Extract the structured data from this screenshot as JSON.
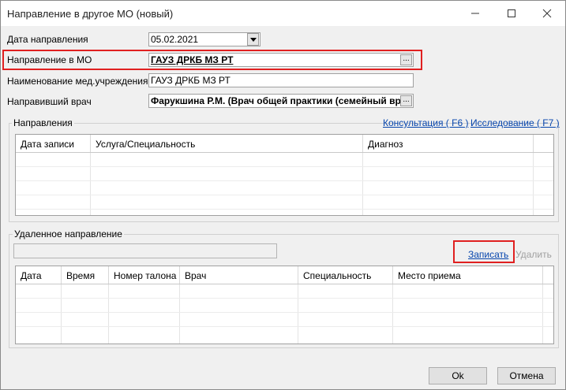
{
  "window": {
    "title": "Направление в другое МО (новый)"
  },
  "form": {
    "date_label": "Дата направления",
    "date_value": "05.02.2021",
    "mo_label": "Направление в МО",
    "mo_value": "ГАУЗ ДРКБ МЗ РТ",
    "institution_label": "Наименование мед.учреждения",
    "institution_value": "ГАУЗ ДРКБ МЗ РТ",
    "doctor_label": "Направивший врач",
    "doctor_value": "Фарукшина Р.М. (Врач общей практики (семейный вр",
    "dots": "..."
  },
  "referrals": {
    "title": "Направления",
    "consult_link": "Консультация ( F6 )",
    "research_link": "Исследование ( F7 )",
    "columns": [
      "Дата записи",
      "Услуга/Специальность",
      "Диагноз"
    ]
  },
  "remote": {
    "title": "Удаленное направление",
    "record_link": "Записать",
    "delete_link": "Удалить",
    "columns": [
      "Дата",
      "Время",
      "Номер талона",
      "Врач",
      "Специальность",
      "Место приема"
    ]
  },
  "buttons": {
    "ok": "Ok",
    "cancel": "Отмена"
  },
  "colors": {
    "highlight": "#e02020",
    "link": "#0645ad"
  }
}
